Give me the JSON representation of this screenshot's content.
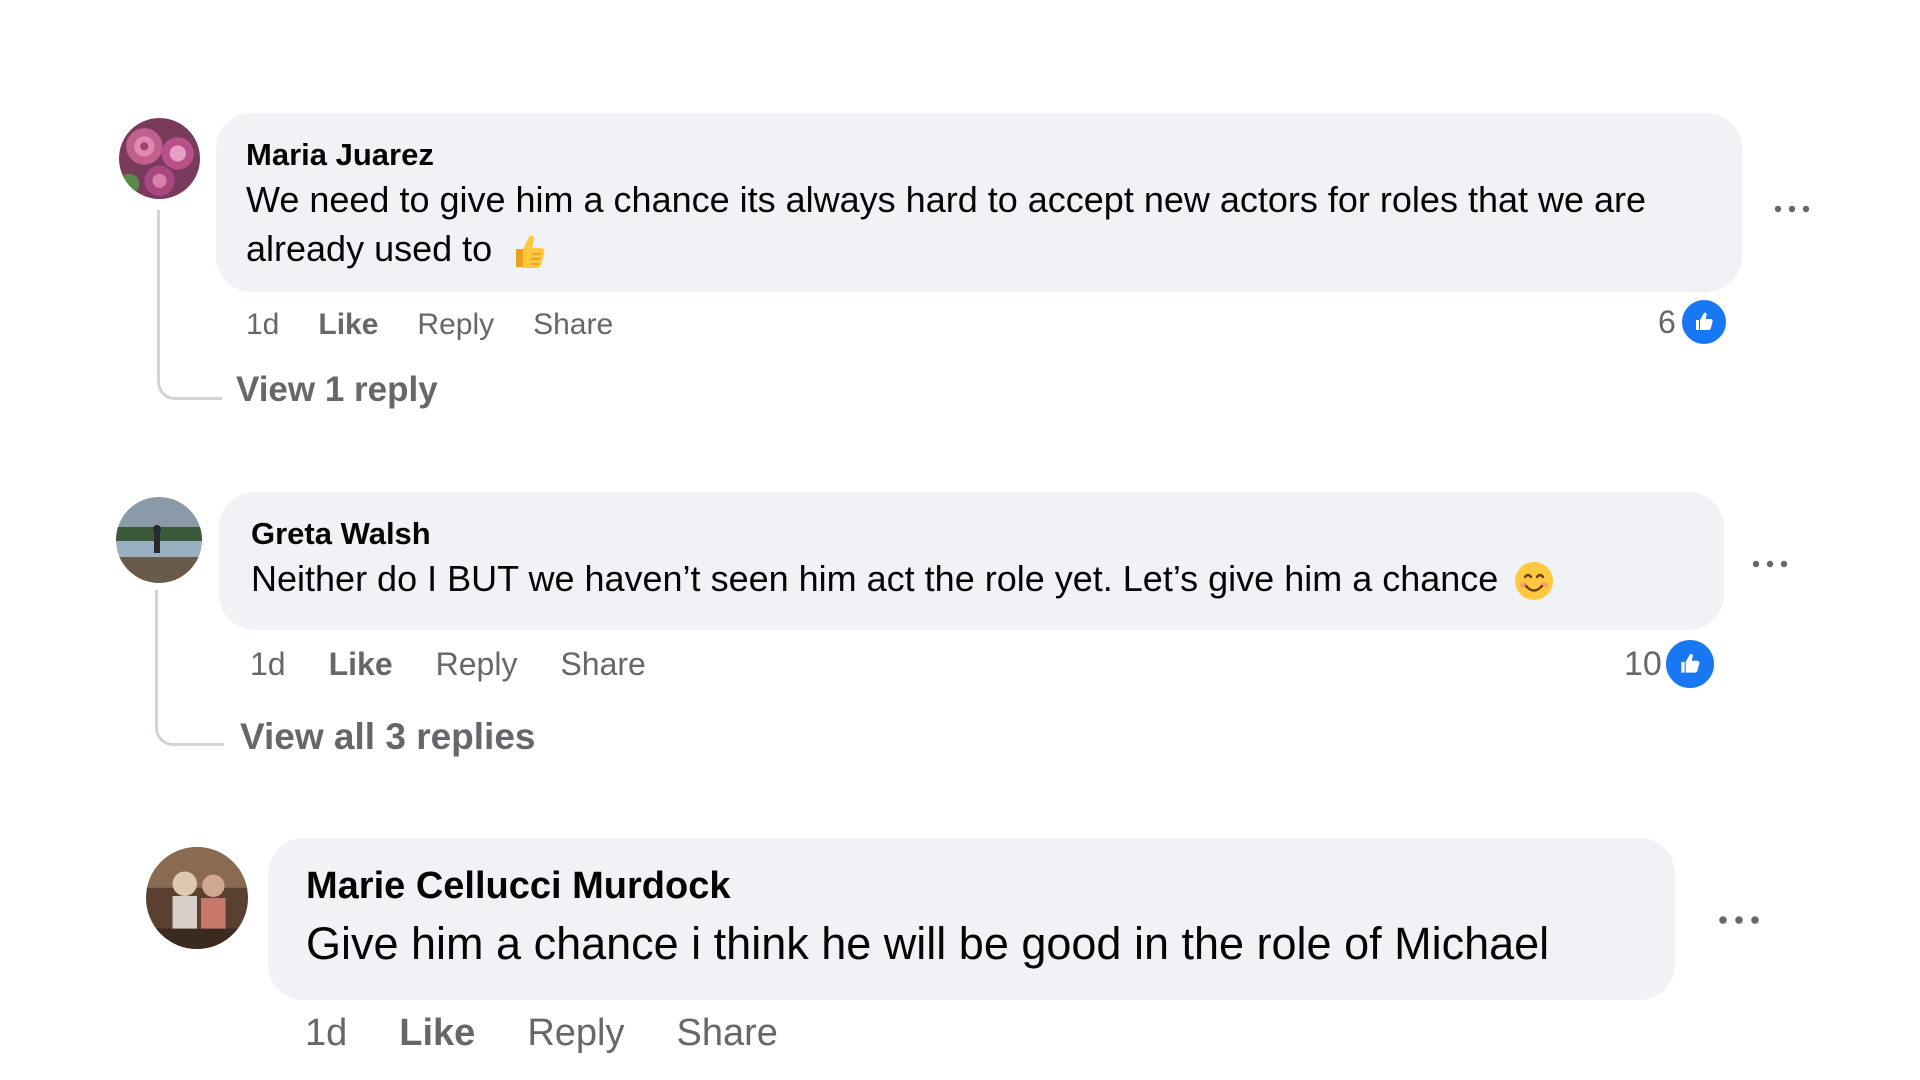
{
  "comments": [
    {
      "author": "Maria Juarez",
      "text": "We need to give him a chance its always hard to accept new actors for roles that we are already used to",
      "emoji": "thumbs-up-emoji",
      "time": "1d",
      "like_label": "Like",
      "reply_label": "Reply",
      "share_label": "Share",
      "reaction_count": "6",
      "view_replies": "View 1 reply"
    },
    {
      "author": "Greta Walsh",
      "text": "Neither do I BUT we haven’t seen him act the role yet. Let’s give him a chance",
      "emoji": "smiling-face-emoji",
      "time": "1d",
      "like_label": "Like",
      "reply_label": "Reply",
      "share_label": "Share",
      "reaction_count": "10",
      "view_replies": "View all 3 replies"
    },
    {
      "author": "Marie Cellucci Murdock",
      "text": "Give him a chance i think he will be good in the role of Michael",
      "time": "1d",
      "like_label": "Like",
      "reply_label": "Reply",
      "share_label": "Share"
    }
  ],
  "icons": {
    "more": "more-options-icon",
    "like_reaction": "like-reaction-icon"
  },
  "colors": {
    "bubble": "#f0f2f5",
    "secondary_text": "#65676b",
    "like_blue": "#1877f2"
  }
}
